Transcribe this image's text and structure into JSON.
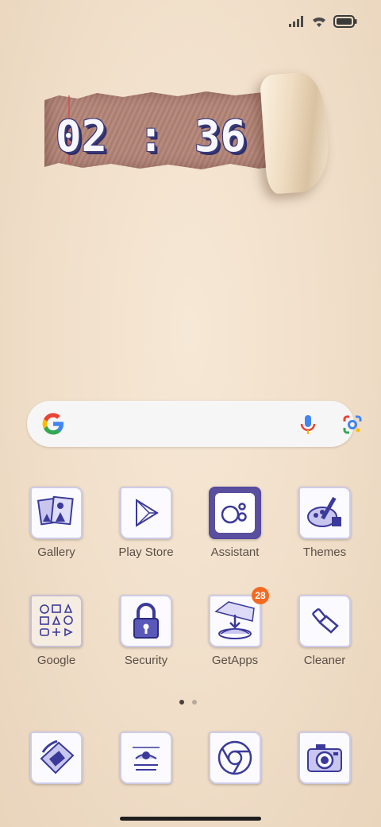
{
  "status_bar": {
    "icons": [
      "signal-icon",
      "wifi-icon",
      "battery-icon"
    ]
  },
  "clock": {
    "hour": "02",
    "separator": ":",
    "minute": "36"
  },
  "search": {
    "placeholder": "",
    "icons": [
      "google-logo",
      "microphone-icon",
      "lens-camera-icon"
    ]
  },
  "apps_row1": [
    {
      "label": "Gallery",
      "icon": "gallery-icon"
    },
    {
      "label": "Play Store",
      "icon": "play-store-icon"
    },
    {
      "label": "Assistant",
      "icon": "assistant-icon"
    },
    {
      "label": "Themes",
      "icon": "themes-icon"
    }
  ],
  "apps_row2": [
    {
      "label": "Google",
      "icon": "google-folder-icon"
    },
    {
      "label": "Security",
      "icon": "security-icon"
    },
    {
      "label": "GetApps",
      "icon": "getapps-icon",
      "badge": "28"
    },
    {
      "label": "Cleaner",
      "icon": "cleaner-icon"
    }
  ],
  "dock": [
    {
      "icon": "phone-icon"
    },
    {
      "icon": "messaging-icon"
    },
    {
      "icon": "chrome-icon"
    },
    {
      "icon": "camera-icon"
    }
  ],
  "page_indicator": {
    "pages": 2,
    "current": 1
  },
  "colors": {
    "wallpaper": "#f0dec8",
    "ink": "#3b3a9a",
    "badge": "#f26a22",
    "label": "#5a4f47"
  }
}
